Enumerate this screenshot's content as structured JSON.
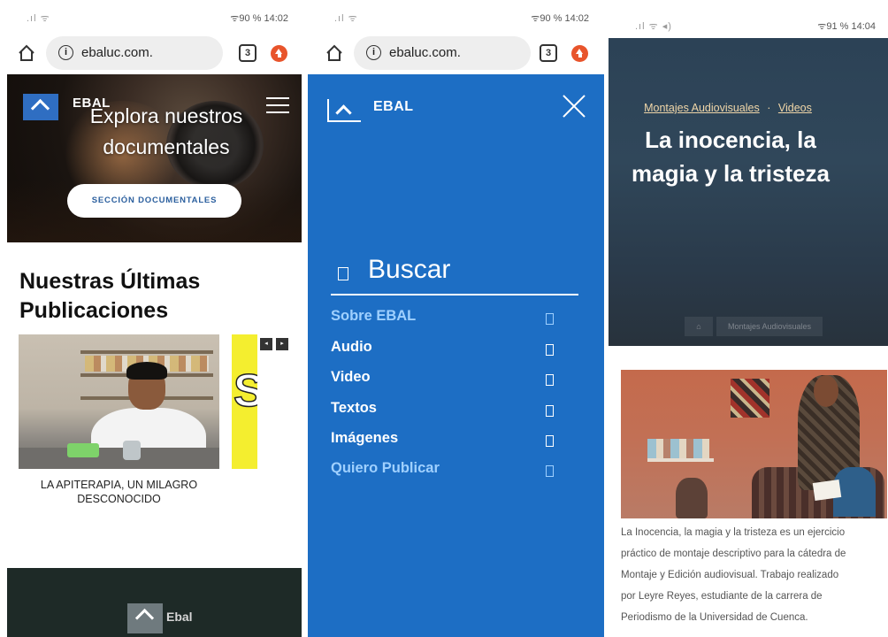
{
  "screens": [
    {
      "status": {
        "signal": ".ıl ᯤ",
        "right": "ᯤ90 %  14:02"
      },
      "browser": {
        "url": "ebaluc.com.",
        "tab_count": "3"
      },
      "hero": {
        "brand": "EBAL",
        "title_line1": "Explora nuestros",
        "title_line2": "documentales",
        "button": "SECCIÓN DOCUMENTALES"
      },
      "section_title_line1": "Nuestras Últimas",
      "section_title_line2": "Publicaciones",
      "carousel": {
        "prev": "◂",
        "next": "▸"
      },
      "card": {
        "caption_line1": "LA APITERAPIA, UN MILAGRO",
        "caption_line2": "DESCONOCIDO"
      },
      "footer": {
        "brand": "Ebal"
      }
    },
    {
      "status": {
        "signal": ".ıl ᯤ",
        "right": "ᯤ90 %  14:02"
      },
      "browser": {
        "url": "ebaluc.com.",
        "tab_count": "3"
      },
      "menu": {
        "brand": "EBAL",
        "search_label": "Buscar",
        "items": [
          {
            "label": "Sobre EBAL"
          },
          {
            "label": "Audio"
          },
          {
            "label": "Video"
          },
          {
            "label": "Textos"
          },
          {
            "label": "Imágenes"
          },
          {
            "label": "Quiero Publicar"
          }
        ]
      }
    },
    {
      "status": {
        "signal": ".ıl ᯤ ◂)",
        "right": "ᯤ91 %  14:04"
      },
      "hero": {
        "category1": "Montajes Audiovisuales",
        "separator": "·",
        "category2": "Videos",
        "title_line1": "La inocencia, la",
        "title_line2": "magia y la tristeza",
        "breadcrumb_home": "⌂",
        "breadcrumb_item": "Montajes Audiovisuales"
      },
      "description_lines": [
        "La Inocencia, la magia y la tristeza es un ejercicio",
        "práctico de montaje descriptivo para la cátedra de",
        "Montaje y Edición audiovisual. Trabajo realizado",
        "por Leyre Reyes, estudiante de la carrera de",
        "Periodismo de la Universidad de Cuenca."
      ]
    }
  ]
}
